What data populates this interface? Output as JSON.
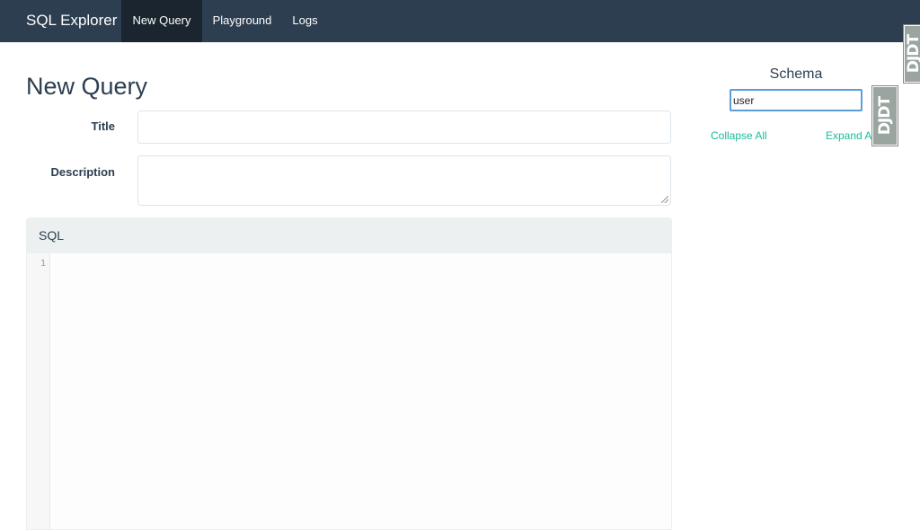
{
  "navbar": {
    "brand": "SQL Explorer",
    "items": [
      {
        "label": "New Query",
        "active": true
      },
      {
        "label": "Playground",
        "active": false
      },
      {
        "label": "Logs",
        "active": false
      }
    ]
  },
  "page": {
    "title": "New Query"
  },
  "form": {
    "title_label": "Title",
    "title_value": "",
    "description_label": "Description",
    "description_value": ""
  },
  "sql": {
    "heading": "SQL",
    "line_numbers": [
      "1"
    ],
    "code": ""
  },
  "schema": {
    "title": "Schema",
    "search_value": "user",
    "collapse_all": "Collapse All",
    "expand_all": "Expand All"
  },
  "debug_toolbar": {
    "handle_text": "DJDT"
  },
  "colors": {
    "navbar": "#2c3e50",
    "navbar_active": "#1a252f",
    "link": "#18bc9c",
    "panel_heading": "#ecf0f1"
  }
}
